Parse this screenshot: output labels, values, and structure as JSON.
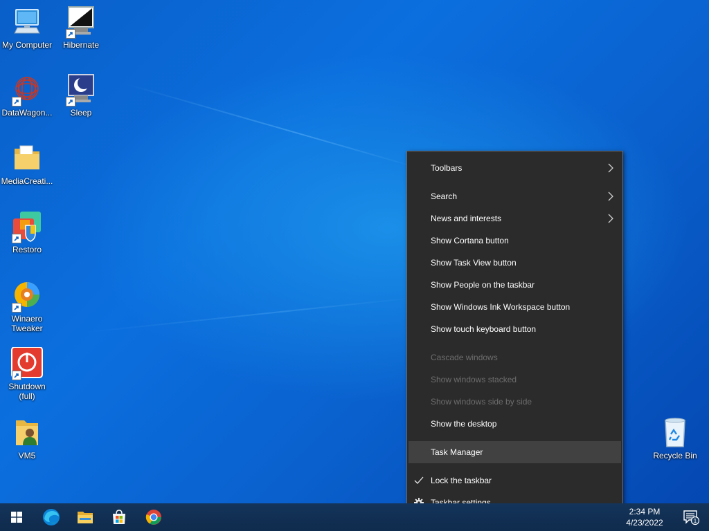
{
  "desktop": {
    "icons": [
      {
        "label": "My Computer",
        "icon": "computer-icon"
      },
      {
        "label": "Hibernate",
        "icon": "hibernate-icon"
      },
      {
        "label": "DataWagon...",
        "icon": "datawagon-icon"
      },
      {
        "label": "Sleep",
        "icon": "sleep-icon"
      },
      {
        "label": "MediaCreati...",
        "icon": "folder-icon"
      },
      {
        "label": "Restoro",
        "icon": "restoro-icon"
      },
      {
        "label": "Winaero\nTweaker",
        "icon": "winaero-tweaker-icon"
      },
      {
        "label": "Shutdown\n(full)",
        "icon": "shutdown-icon"
      },
      {
        "label": "VM5",
        "icon": "user-folder-icon"
      },
      {
        "label": "Recycle Bin",
        "icon": "recycle-bin-icon"
      }
    ]
  },
  "context_menu": {
    "items": [
      {
        "label": "Toolbars",
        "submenu": true
      },
      {
        "label": "Search",
        "submenu": true
      },
      {
        "label": "News and interests",
        "submenu": true
      },
      {
        "label": "Show Cortana button"
      },
      {
        "label": "Show Task View button"
      },
      {
        "label": "Show People on the taskbar"
      },
      {
        "label": "Show Windows Ink Workspace button"
      },
      {
        "label": "Show touch keyboard button"
      },
      {
        "label": "Cascade windows",
        "disabled": true
      },
      {
        "label": "Show windows stacked",
        "disabled": true
      },
      {
        "label": "Show windows side by side",
        "disabled": true
      },
      {
        "label": "Show the desktop"
      },
      {
        "label": "Task Manager",
        "highlighted": true
      },
      {
        "label": "Lock the taskbar",
        "checked": true
      },
      {
        "label": "Taskbar settings",
        "icon": "gear-icon"
      }
    ]
  },
  "taskbar": {
    "pinned": [
      "start-icon",
      "edge-icon",
      "file-explorer-icon",
      "store-icon",
      "chrome-icon"
    ],
    "clock": {
      "time": "2:34 PM",
      "date": "4/23/2022"
    },
    "notification_count": "1"
  },
  "colors": {
    "menu_bg": "#2b2b2b",
    "menu_highlight": "#414141",
    "menu_disabled_text": "#6d6d6d",
    "taskbar_bg": "#12304f"
  }
}
